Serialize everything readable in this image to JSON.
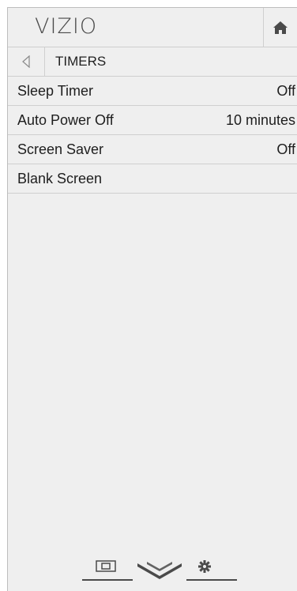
{
  "header": {
    "logo": "VIZIO",
    "home_icon": "home-icon"
  },
  "subheader": {
    "back_icon": "back-triangle-icon",
    "title": "TIMERS"
  },
  "menu": {
    "items": [
      {
        "label": "Sleep Timer",
        "value": "Off"
      },
      {
        "label": "Auto Power Off",
        "value": "10 minutes"
      },
      {
        "label": "Screen Saver",
        "value": "Off"
      },
      {
        "label": "Blank Screen",
        "value": ""
      }
    ]
  },
  "footer": {
    "icons": [
      "input-icon",
      "vizio-v-icon",
      "settings-gear-icon"
    ]
  },
  "colors": {
    "panel_background": "#efefef",
    "divider": "#cfcfcf",
    "text": "#1e1e1e",
    "icon": "#4a4a4a"
  }
}
